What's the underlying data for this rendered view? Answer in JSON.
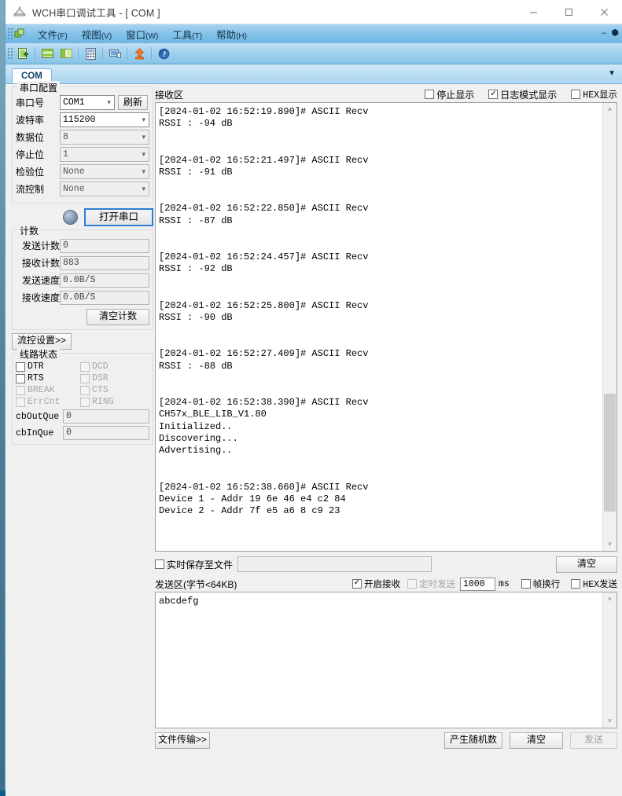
{
  "window": {
    "title": "WCH串口调试工具 - [ COM ]",
    "icon": "app-icon",
    "minimize": "—",
    "maximize": "☐",
    "close": "✕",
    "inner_minimize": "–",
    "inner_restore": "❐"
  },
  "menu": {
    "items": [
      {
        "label": "文件",
        "mnemonic": "(F)"
      },
      {
        "label": "视图",
        "mnemonic": "(V)"
      },
      {
        "label": "窗口",
        "mnemonic": "(W)"
      },
      {
        "label": "工具",
        "mnemonic": "(T)"
      },
      {
        "label": "帮助",
        "mnemonic": "(H)"
      }
    ]
  },
  "toolbar": {
    "buttons": [
      "new-document-icon",
      "horizontal-tile-icon",
      "vertical-tile-icon",
      "calculator-icon",
      "computer-icon",
      "upload-icon",
      "help-icon"
    ],
    "overflow": "»"
  },
  "tabs": {
    "items": [
      {
        "label": "COM",
        "active": true
      }
    ],
    "dropdown": "▼"
  },
  "serial_config": {
    "title": "串口配置",
    "fields": [
      {
        "label": "串口号",
        "value": "COM1",
        "white": true
      },
      {
        "label": "波特率",
        "value": "115200",
        "white": true
      },
      {
        "label": "数据位",
        "value": "8",
        "white": false
      },
      {
        "label": "停止位",
        "value": "1",
        "white": false
      },
      {
        "label": "检验位",
        "value": "None",
        "white": false
      },
      {
        "label": "流控制",
        "value": "None",
        "white": false
      }
    ],
    "refresh_label": "刷新",
    "open_label": "打开串口"
  },
  "counters": {
    "title": "计数",
    "rows": [
      {
        "label": "发送计数",
        "value": "0"
      },
      {
        "label": "接收计数",
        "value": "883"
      },
      {
        "label": "发送速度",
        "value": "0.0B/S"
      },
      {
        "label": "接收速度",
        "value": "0.0B/S"
      }
    ],
    "clear_label": "清空计数"
  },
  "flow_settings_label": "流控设置>>",
  "line_status": {
    "title": "线路状态",
    "left_checks": [
      {
        "label": "DTR",
        "checked": false,
        "enabled": true
      },
      {
        "label": "RTS",
        "checked": false,
        "enabled": true
      },
      {
        "label": "BREAK",
        "checked": false,
        "enabled": false
      },
      {
        "label": "ErrCnt",
        "checked": false,
        "enabled": false
      }
    ],
    "right_checks": [
      {
        "label": "DCD",
        "checked": false,
        "enabled": false
      },
      {
        "label": "DSR",
        "checked": false,
        "enabled": false
      },
      {
        "label": "CTS",
        "checked": false,
        "enabled": false
      },
      {
        "label": "RING",
        "checked": false,
        "enabled": false
      }
    ],
    "queues": [
      {
        "label": "cbOutQue",
        "value": "0"
      },
      {
        "label": "cbInQue",
        "value": "0"
      }
    ]
  },
  "receive": {
    "title": "接收区",
    "options": [
      {
        "label": "停止显示",
        "checked": false
      },
      {
        "label": "日志模式显示",
        "checked": true
      },
      {
        "label": "HEX显示",
        "checked": false,
        "mono": true
      }
    ],
    "log": "[2024-01-02 16:52:19.890]# ASCII Recv\nRSSI : -94 dB\n\n\n[2024-01-02 16:52:21.497]# ASCII Recv\nRSSI : -91 dB\n\n\n[2024-01-02 16:52:22.850]# ASCII Recv\nRSSI : -87 dB\n\n\n[2024-01-02 16:52:24.457]# ASCII Recv\nRSSI : -92 dB\n\n\n[2024-01-02 16:52:25.800]# ASCII Recv\nRSSI : -90 dB\n\n\n[2024-01-02 16:52:27.409]# ASCII Recv\nRSSI : -88 dB\n\n\n[2024-01-02 16:52:38.390]# ASCII Recv\nCH57x_BLE_LIB_V1.80\nInitialized..\nDiscovering...\nAdvertising..\n\n\n[2024-01-02 16:52:38.660]# ASCII Recv\nDevice 1 - Addr 19 6e 46 e4 c2 84\nDevice 2 - Addr 7f e5 a6 8 c9 23",
    "scroll_up": "˄",
    "scroll_down": "˅",
    "save_to_file": {
      "label": "实时保存至文件",
      "checked": false,
      "path": ""
    },
    "clear_label": "清空"
  },
  "send": {
    "title": "发送区(字节<64KB)",
    "options": [
      {
        "label": "开启接收",
        "checked": true,
        "enabled": true
      },
      {
        "label": "定时发送",
        "checked": false,
        "enabled": false
      }
    ],
    "interval_value": "1000",
    "interval_unit": "ms",
    "frame_newline": {
      "label": "帧换行",
      "checked": false
    },
    "hex_send": {
      "label": "HEX发送",
      "checked": false
    },
    "text": "abcdefg",
    "file_transfer_label": "文件传输>>",
    "random_label": "产生随机数",
    "clear_label": "清空",
    "send_label": "发送"
  },
  "colors": {
    "accent": "#2b7fd4",
    "titlebar": "#ffffff",
    "menubar": "#84c2e8",
    "panel": "#f0f0f0"
  }
}
